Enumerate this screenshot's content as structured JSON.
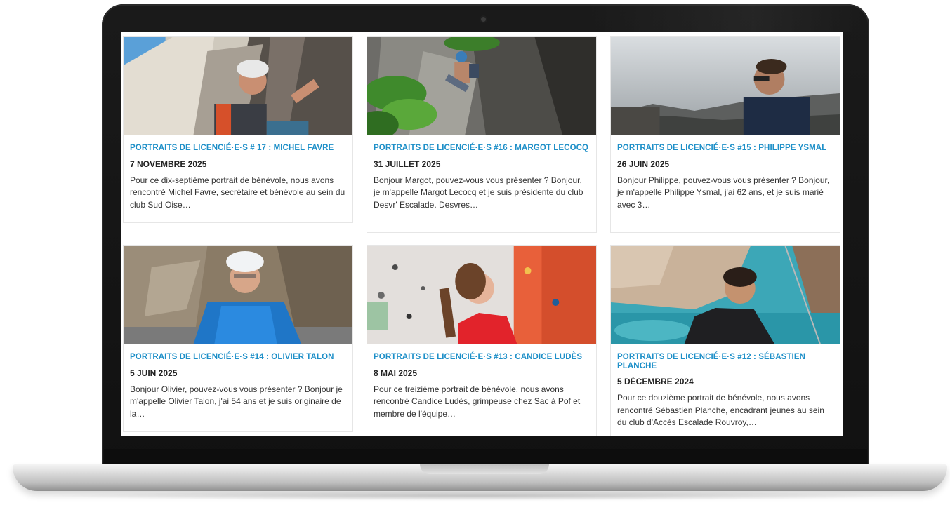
{
  "posts": [
    {
      "title": "PORTRAITS DE LICENCIÉ·E·S # 17 : MICHEL FAVRE",
      "date": "7 NOVEMBRE 2025",
      "excerpt": "Pour ce dix-septième portrait de bénévole, nous avons rencontré Michel Favre, secrétaire et bénévole au sein du club Sud Oise…"
    },
    {
      "title": "PORTRAITS DE LICENCIÉ·E·S #16 : MARGOT LECOCQ",
      "date": "31 JUILLET 2025",
      "excerpt": " Bonjour Margot, pouvez-vous vous présenter ? Bonjour, je m'appelle Margot Lecocq et je suis présidente du club Desvr' Escalade. Desvres…"
    },
    {
      "title": "PORTRAITS DE LICENCIÉ·E·S #15 : PHILIPPE YSMAL",
      "date": "26 JUIN 2025",
      "excerpt": "Bonjour Philippe, pouvez-vous vous présenter ? Bonjour, je m'appelle Philippe Ysmal, j'ai 62 ans, et je suis marié avec 3…"
    },
    {
      "title": "PORTRAITS DE LICENCIÉ·E·S #14 : OLIVIER TALON",
      "date": "5 JUIN 2025",
      "excerpt": "Bonjour Olivier, pouvez-vous vous présenter ? Bonjour je m'appelle Olivier Talon, j'ai 54 ans et je suis originaire de la…"
    },
    {
      "title": "PORTRAITS DE LICENCIÉ·E·S #13 : CANDICE LUDÈS",
      "date": "8 MAI 2025",
      "excerpt": "Pour ce treizième portrait de bénévole, nous avons rencontré Candice Ludès, grimpeuse chez Sac à Pof et membre de l'équipe…"
    },
    {
      "title": "PORTRAITS DE LICENCIÉ·E·S #12 : SÉBASTIEN PLANCHE",
      "date": "5 DÉCEMBRE 2024",
      "excerpt": "Pour ce douzième portrait de bénévole, nous avons rencontré Sébastien Planche, encadrant jeunes au sein du club d'Accès Escalade Rouvroy,…"
    }
  ],
  "colors": {
    "title_link": "#1d8fc8",
    "date_text": "#222222",
    "body_text": "#333333"
  }
}
